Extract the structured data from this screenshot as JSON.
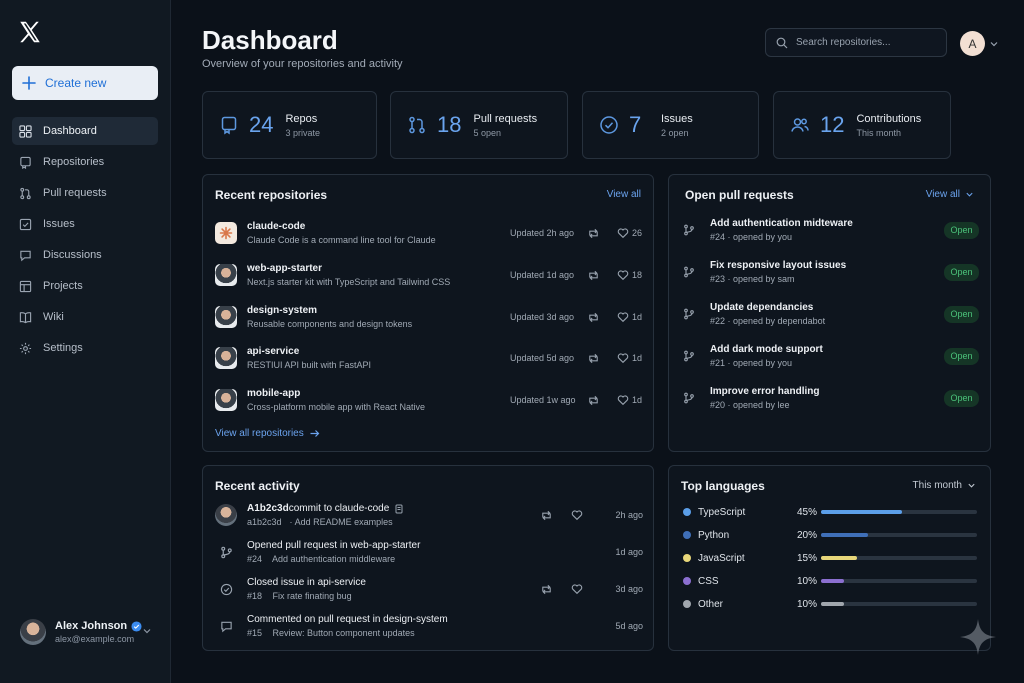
{
  "sidebar": {
    "create_label": "Create new",
    "items": [
      {
        "label": "Dashboard",
        "icon": "grid-icon",
        "active": true
      },
      {
        "label": "Repositories",
        "icon": "repo-icon"
      },
      {
        "label": "Pull requests",
        "icon": "pull-request-icon"
      },
      {
        "label": "Issues",
        "icon": "issue-icon"
      },
      {
        "label": "Discussions",
        "icon": "discussion-icon"
      },
      {
        "label": "Projects",
        "icon": "project-icon"
      },
      {
        "label": "Wiki",
        "icon": "book-icon"
      },
      {
        "label": "Settings",
        "icon": "gear-icon"
      }
    ],
    "user": {
      "name": "Alex Johnson",
      "email": "alex@example.com"
    }
  },
  "header": {
    "title": "Dashboard",
    "subtitle": "Overview of your repositories and activity",
    "search_placeholder": "Search repositories...",
    "avatar_initial": "A"
  },
  "stats": [
    {
      "value": "24",
      "label": "Repos",
      "sub": "3 private",
      "icon": "repo-icon"
    },
    {
      "value": "18",
      "label": "Pull requests",
      "sub": "5 open",
      "icon": "pull-request-icon"
    },
    {
      "value": "7",
      "label": "Issues",
      "sub": "2 open",
      "icon": "issue-icon"
    },
    {
      "value": "12",
      "label": "Contributions",
      "sub": "This month",
      "icon": "people-icon"
    }
  ],
  "recent_repos": {
    "title": "Recent repositories",
    "view_all": "View all",
    "footer_link": "View all repositories",
    "items": [
      {
        "name": "claude-code",
        "desc": "Claude Code is a command line tool for Claude",
        "updated": "Updated 2h ago",
        "count": "26"
      },
      {
        "name": "web-app-starter",
        "desc": "Next.js starter kit with TypeScript and Tailwind CSS",
        "updated": "Updated 1d ago",
        "count": "18"
      },
      {
        "name": "design-system",
        "desc": "Reusable components and design tokens",
        "updated": "Updated 3d ago",
        "count": "1d"
      },
      {
        "name": "api-service",
        "desc": "RESTIUI API built with FastAPI",
        "updated": "Updated 5d ago",
        "count": "1d"
      },
      {
        "name": "mobile-app",
        "desc": "Cross-platform mobile app with React Native",
        "updated": "Updated 1w ago",
        "count": "1d"
      }
    ]
  },
  "open_prs": {
    "title": "Open pull requests",
    "view_all": "View all",
    "items": [
      {
        "title": "Add authentication midteware",
        "meta": "#24 · opened by you",
        "status": "Open"
      },
      {
        "title": "Fix responsive layout issues",
        "meta": "#23 · opened by sam",
        "status": "Open"
      },
      {
        "title": "Update dependancies",
        "meta": "#22 · opened by dependabot",
        "status": "Open"
      },
      {
        "title": "Add dark mode support",
        "meta": "#21 · opened by you",
        "status": "Open"
      },
      {
        "title": "Improve error handling",
        "meta": "#20 · opened by lee",
        "status": "Open"
      }
    ]
  },
  "recent_activity": {
    "title": "Recent activity",
    "items": [
      {
        "title_strong": "A1b2c3d",
        "title_rest": " commit to claude-code",
        "ref": "a1b2c3d",
        "sub": "Add README examples",
        "time": "2h ago",
        "icon": "avatar"
      },
      {
        "title_strong": "",
        "title_rest": "Opened pull request in web-app-starter",
        "ref": "#24",
        "sub": "Add authentication middleware",
        "time": "1d ago",
        "icon": "pull-request-icon"
      },
      {
        "title_strong": "",
        "title_rest": "Closed issue in api-service",
        "ref": "#18",
        "sub": "Fix rate finating bug",
        "time": "3d ago",
        "icon": "check-circle-icon"
      },
      {
        "title_strong": "",
        "title_rest": "Commented on pull request in design-system",
        "ref": "#15",
        "sub": "Review: Button component updates",
        "time": "5d ago",
        "icon": "comment-icon"
      }
    ]
  },
  "top_languages": {
    "title": "Top languages",
    "period": "This month",
    "items": [
      {
        "name": "TypeScript",
        "pct": "45%",
        "value": 0.52,
        "color": "#5b9ee8"
      },
      {
        "name": "Python",
        "pct": "20%",
        "value": 0.3,
        "color": "#3f6fb8"
      },
      {
        "name": "JavaScript",
        "pct": "15%",
        "value": 0.23,
        "color": "#e8d77a"
      },
      {
        "name": "CSS",
        "pct": "10%",
        "value": 0.15,
        "color": "#8b6fd0"
      },
      {
        "name": "Other",
        "pct": "10%",
        "value": 0.15,
        "color": "#a0a6ad"
      }
    ]
  }
}
